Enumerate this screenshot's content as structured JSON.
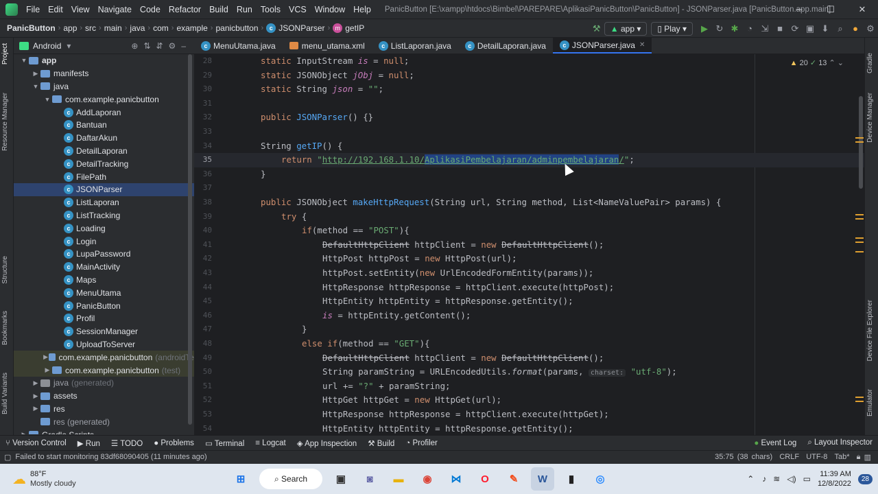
{
  "menu": {
    "items": [
      "File",
      "Edit",
      "View",
      "Navigate",
      "Code",
      "Refactor",
      "Build",
      "Run",
      "Tools",
      "VCS",
      "Window",
      "Help"
    ],
    "window_title": "PanicButton [E:\\xampp\\htdocs\\Bimbel\\PAREPARE\\AplikasiPanicButton\\PanicButton] - JSONParser.java [PanicButton.app.main]"
  },
  "nav": {
    "crumbs": [
      "PanicButton",
      "app",
      "src",
      "main",
      "java",
      "com",
      "example",
      "panicbutton"
    ],
    "file_crumb": "JSONParser",
    "method_crumb": "getIP",
    "module": "app",
    "device": "Play"
  },
  "project": {
    "view": "Android"
  },
  "tree": [
    {
      "label": "app",
      "level": 0,
      "type": "folder",
      "open": true
    },
    {
      "label": "manifests",
      "level": 1,
      "type": "folder"
    },
    {
      "label": "java",
      "level": 1,
      "type": "folder",
      "open": true
    },
    {
      "label": "com.example.panicbutton",
      "level": 2,
      "type": "folder",
      "open": true
    },
    {
      "label": "AddLaporan",
      "level": 3,
      "type": "class"
    },
    {
      "label": "Bantuan",
      "level": 3,
      "type": "class"
    },
    {
      "label": "DaftarAkun",
      "level": 3,
      "type": "class"
    },
    {
      "label": "DetailLaporan",
      "level": 3,
      "type": "class"
    },
    {
      "label": "DetailTracking",
      "level": 3,
      "type": "class"
    },
    {
      "label": "FilePath",
      "level": 3,
      "type": "class"
    },
    {
      "label": "JSONParser",
      "level": 3,
      "type": "class",
      "selected": true
    },
    {
      "label": "ListLaporan",
      "level": 3,
      "type": "class"
    },
    {
      "label": "ListTracking",
      "level": 3,
      "type": "class"
    },
    {
      "label": "Loading",
      "level": 3,
      "type": "class"
    },
    {
      "label": "Login",
      "level": 3,
      "type": "class"
    },
    {
      "label": "LupaPassword",
      "level": 3,
      "type": "class"
    },
    {
      "label": "MainActivity",
      "level": 3,
      "type": "class"
    },
    {
      "label": "Maps",
      "level": 3,
      "type": "class"
    },
    {
      "label": "MenuUtama",
      "level": 3,
      "type": "class"
    },
    {
      "label": "PanicButton",
      "level": 3,
      "type": "class"
    },
    {
      "label": "Profil",
      "level": 3,
      "type": "class"
    },
    {
      "label": "SessionManager",
      "level": 3,
      "type": "class"
    },
    {
      "label": "UploadToServer",
      "level": 3,
      "type": "class"
    },
    {
      "label": "com.example.panicbutton",
      "sub": "(androidTe",
      "level": 2,
      "type": "folder",
      "mod": true
    },
    {
      "label": "com.example.panicbutton",
      "sub": "(test)",
      "level": 2,
      "type": "folder",
      "mod": true
    },
    {
      "label": "java",
      "sub": "(generated)",
      "level": 1,
      "type": "folder",
      "gray": true
    },
    {
      "label": "assets",
      "level": 1,
      "type": "folder"
    },
    {
      "label": "res",
      "level": 1,
      "type": "folder"
    },
    {
      "label": "res (generated)",
      "level": 1,
      "type": "folder",
      "noarrow": true
    },
    {
      "label": "Gradle Scripts",
      "level": 0,
      "type": "folder"
    }
  ],
  "tabs": [
    {
      "label": "MenuUtama.java",
      "icon": "class"
    },
    {
      "label": "menu_utama.xml",
      "icon": "xml"
    },
    {
      "label": "ListLaporan.java",
      "icon": "class"
    },
    {
      "label": "DetailLaporan.java",
      "icon": "class"
    },
    {
      "label": "JSONParser.java",
      "icon": "class",
      "active": true
    }
  ],
  "editor": {
    "warnings": "20",
    "weak_warnings": "13",
    "lines": [
      {
        "n": "28",
        "html": "<span class='kw'>static</span> InputStream <span class='it'>is</span> = <span class='kw'>null</span>;",
        "ind": 0
      },
      {
        "n": "29",
        "html": "<span class='kw'>static</span> JSONObject <span class='it'>jObj</span> = <span class='kw'>null</span>;",
        "ind": 0
      },
      {
        "n": "30",
        "html": "<span class='kw'>static</span> String <span class='it'>json</span> = <span class='str'>\"\"</span>;",
        "ind": 0
      },
      {
        "n": "31",
        "html": "",
        "ind": 0
      },
      {
        "n": "32",
        "html": "<span class='kw'>public</span> <span class='fn'>JSONParser</span>() {}",
        "ind": 0
      },
      {
        "n": "33",
        "html": "",
        "ind": 0
      },
      {
        "n": "34",
        "html": "String <span class='fn'>getIP</span>() {",
        "ind": 0
      },
      {
        "n": "35",
        "html": "<span class='kw'>return</span> <span class='str'>\"<span class='url'>http://192.168.1.10/<span class='selbg'>AplikasiPembelajaran/adminpembelajaran</span>/</span>\"</span>;",
        "ind": 1,
        "current": true
      },
      {
        "n": "36",
        "html": "}",
        "ind": 0
      },
      {
        "n": "37",
        "html": "",
        "ind": 0
      },
      {
        "n": "38",
        "html": "<span class='kw'>public</span> JSONObject <span class='fn'>makeHttpRequest</span>(String url, String method, List&lt;NameValuePair&gt; params) {",
        "ind": 0
      },
      {
        "n": "39",
        "html": "<span class='kw'>try</span> {",
        "ind": 1
      },
      {
        "n": "40",
        "html": "<span class='kw'>if</span>(method == <span class='str'>\"POST\"</span>){",
        "ind": 2
      },
      {
        "n": "41",
        "html": "<span class='strike'>DefaultHttpClient</span> httpClient = <span class='kw'>new</span> <span class='strike'>DefaultHttpClient</span>();",
        "ind": 3
      },
      {
        "n": "42",
        "html": "HttpPost httpPost = <span class='kw'>new</span> HttpPost(url);",
        "ind": 3
      },
      {
        "n": "43",
        "html": "httpPost.setEntity(<span class='kw'>new</span> UrlEncodedFormEntity(params));",
        "ind": 3
      },
      {
        "n": "44",
        "html": "HttpResponse httpResponse = httpClient.execute(httpPost);",
        "ind": 3
      },
      {
        "n": "45",
        "html": "HttpEntity httpEntity = httpResponse.getEntity();",
        "ind": 3
      },
      {
        "n": "46",
        "html": "<span class='it'>is</span> = httpEntity.getContent();",
        "ind": 3
      },
      {
        "n": "47",
        "html": "}",
        "ind": 2
      },
      {
        "n": "48",
        "html": "<span class='kw'>else if</span>(method == <span class='str'>\"GET\"</span>){",
        "ind": 2
      },
      {
        "n": "49",
        "html": "<span class='strike'>DefaultHttpClient</span> httpClient = <span class='kw'>new</span> <span class='strike'>DefaultHttpClient</span>();",
        "ind": 3
      },
      {
        "n": "50",
        "html": "String paramString = URLEncodedUtils.<i>format</i>(params, <span class='hint'>charset:</span> <span class='str'>\"utf-8\"</span>);",
        "ind": 3
      },
      {
        "n": "51",
        "html": "url += <span class='str'>\"?\"</span> + paramString;",
        "ind": 3
      },
      {
        "n": "52",
        "html": "HttpGet httpGet = <span class='kw'>new</span> HttpGet(url);",
        "ind": 3
      },
      {
        "n": "53",
        "html": "HttpResponse httpResponse = httpClient.execute(httpGet);",
        "ind": 3
      },
      {
        "n": "54",
        "html": "HttpEntity httpEntity = httpResponse.getEntity();",
        "ind": 3
      }
    ]
  },
  "bottom_tools": [
    "Version Control",
    "Run",
    "TODO",
    "Problems",
    "Terminal",
    "Logcat",
    "App Inspection",
    "Build",
    "Profiler"
  ],
  "bottom_right": [
    "Event Log",
    "Layout Inspector"
  ],
  "status": {
    "message": "Failed to start monitoring 83df68090405 (11 minutes ago)",
    "position": "35:75 (38 chars)",
    "line_sep": "CRLF",
    "encoding": "UTF-8",
    "indent": "Tab*"
  },
  "side_left": [
    "Project",
    "Resource Manager",
    "Structure",
    "Bookmarks",
    "Build Variants"
  ],
  "side_right": [
    "Gradle",
    "Device Manager",
    "Device File Explorer",
    "Emulator"
  ],
  "taskbar": {
    "temp": "88°F",
    "weather": "Mostly cloudy",
    "search": "Search",
    "time": "11:39 AM",
    "date": "12/8/2022",
    "notif": "28"
  }
}
